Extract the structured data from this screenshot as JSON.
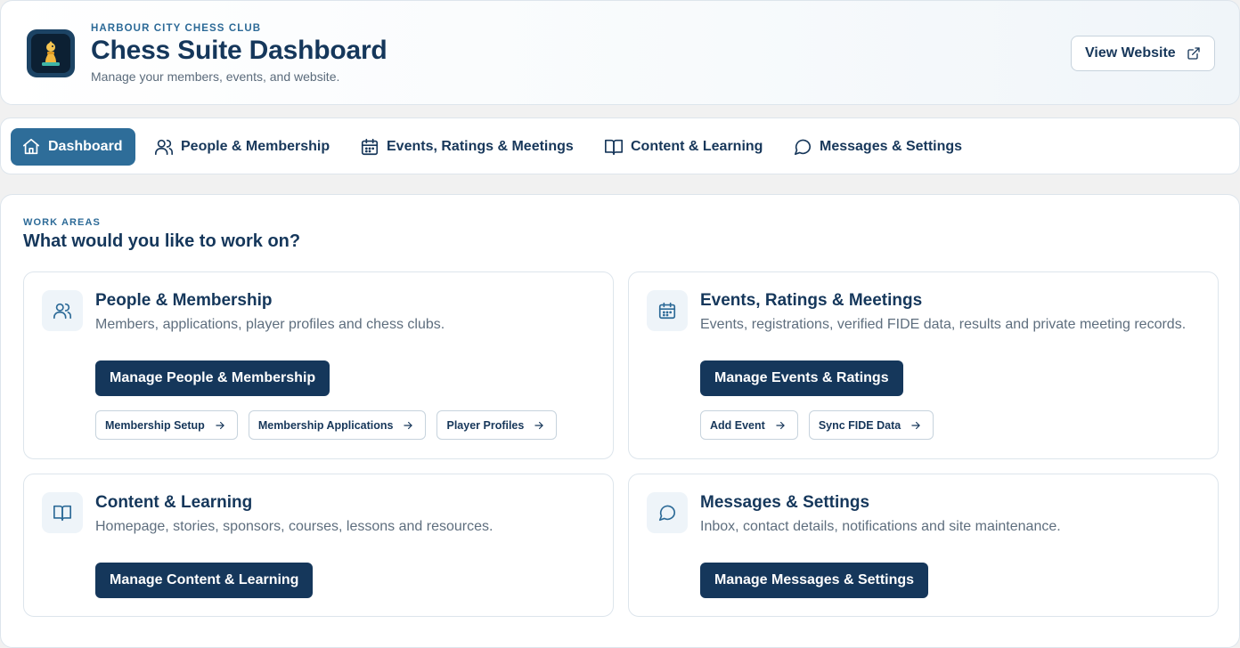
{
  "header": {
    "club_name": "HARBOUR CITY CHESS CLUB",
    "title": "Chess Suite Dashboard",
    "subtitle": "Manage your members, events, and website.",
    "view_website_label": "View Website",
    "logo_icon": "chess-pawn-icon"
  },
  "nav": {
    "items": [
      {
        "label": "Dashboard",
        "icon": "home-icon",
        "active": true
      },
      {
        "label": "People & Membership",
        "icon": "users-icon"
      },
      {
        "label": "Events, Ratings & Meetings",
        "icon": "calendar-icon"
      },
      {
        "label": "Content & Learning",
        "icon": "book-icon"
      },
      {
        "label": "Messages & Settings",
        "icon": "message-icon"
      }
    ]
  },
  "work_areas": {
    "label": "WORK AREAS",
    "title": "What would you like to work on?",
    "cards": [
      {
        "title": "People & Membership",
        "description": "Members, applications, player profiles and chess clubs.",
        "button": "Manage People & Membership",
        "icon": "users-icon",
        "links": [
          "Membership Setup",
          "Membership Applications",
          "Player Profiles"
        ]
      },
      {
        "title": "Events, Ratings & Meetings",
        "description": "Events, registrations, verified FIDE data, results and private meeting records.",
        "button": "Manage Events & Ratings",
        "icon": "calendar-icon",
        "links": [
          "Add Event",
          "Sync FIDE Data"
        ]
      },
      {
        "title": "Content & Learning",
        "description": "Homepage, stories, sponsors, courses, lessons and resources.",
        "button": "Manage Content & Learning",
        "icon": "book-icon",
        "links": []
      },
      {
        "title": "Messages & Settings",
        "description": "Inbox, contact details, notifications and site maintenance.",
        "button": "Manage Messages & Settings",
        "icon": "message-icon",
        "links": []
      }
    ]
  },
  "colors": {
    "navy": "#15375b",
    "accent": "#2e6d99",
    "muted_text": "#5e6e7e",
    "icon_bg": "#eef4f9"
  }
}
